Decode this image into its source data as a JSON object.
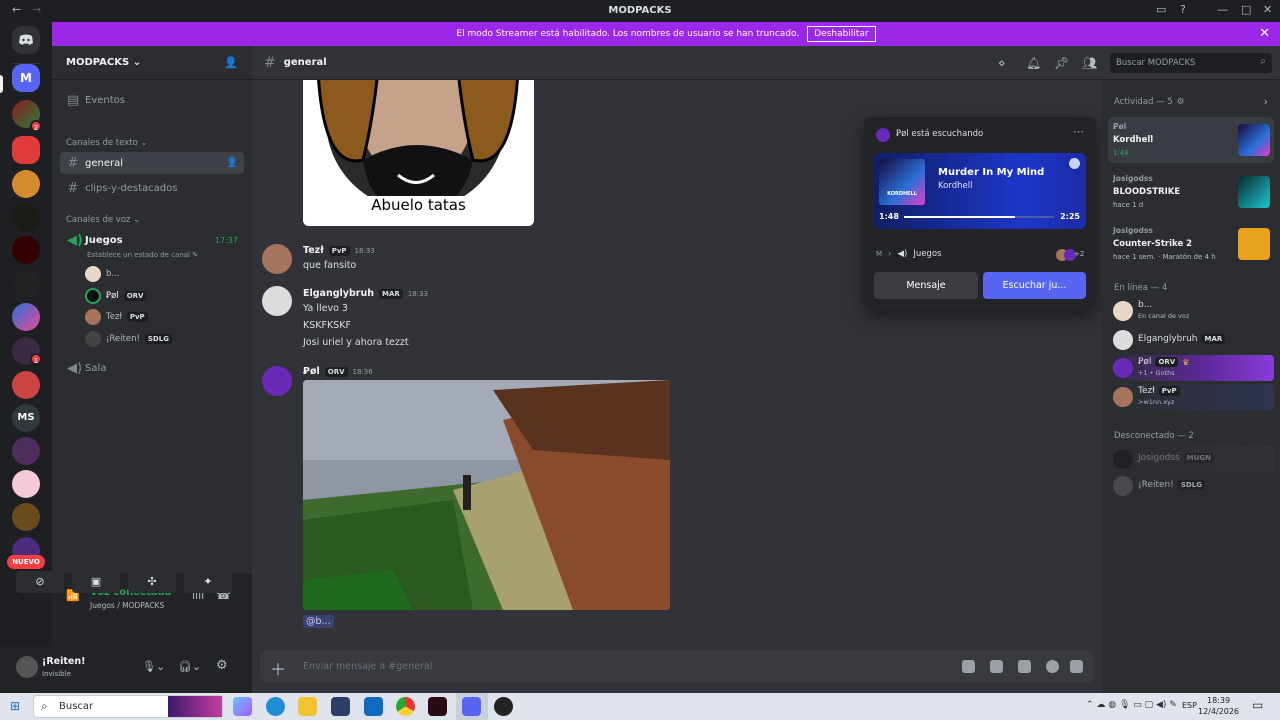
{
  "window": {
    "title": "MODPACKS"
  },
  "banner": {
    "text": "El modo Streamer está habilitado. Los nombres de usuario se han truncado.",
    "button": "Deshabilitar"
  },
  "server": {
    "name": "MODPACKS",
    "badges": [
      "2",
      "1"
    ],
    "new_label": "NUEVO",
    "rail_initial": "M",
    "ms_label": "MS"
  },
  "sidebar": {
    "events": "Eventos",
    "text_category": "Canales de texto",
    "text_channels": [
      "general",
      "clips-y-destacados"
    ],
    "voice_category": "Canales de voz",
    "voice_channel": "Juegos",
    "voice_timer": "17:37",
    "voice_status_prompt": "Establece un estado de canal",
    "voice_users": [
      {
        "name": "b...",
        "tag": ""
      },
      {
        "name": "Ꝑøl",
        "tag": "ORV"
      },
      {
        "name": "Tezł",
        "tag": "PvP"
      },
      {
        "name": "¡Reiten!",
        "tag": "SDLG"
      }
    ],
    "other_voice_channel": "Sala"
  },
  "voice_panel": {
    "status": "Voz conectada",
    "location": "Juegos / MODPACKS"
  },
  "user_panel": {
    "name": "¡Reiten!",
    "status": "Invisible"
  },
  "header": {
    "channel": "general",
    "search_placeholder": "Buscar MODPACKS"
  },
  "messages": [
    {
      "image_caption": "Abuelo tatas"
    },
    {
      "author": "Tezł",
      "tag": "PvP",
      "time": "18:33",
      "lines": [
        "que fansito"
      ]
    },
    {
      "author": "Elganglybruh",
      "tag": "MAR",
      "time": "18:33",
      "lines": [
        "Ya llevo 3",
        "KSKFKSKF",
        "Josi uriel y ahora tezzt"
      ]
    },
    {
      "author": "Ꝑøl",
      "tag": "ORV",
      "time": "18:36",
      "lines": [],
      "mention": "@b..."
    }
  ],
  "composer": {
    "placeholder": "Enviar mensaje a #general"
  },
  "popup": {
    "listening": "Ꝑøl está escuchando",
    "track": "Murder In My Mind",
    "artist": "Kordhell",
    "album_text": "KORDHELL",
    "elapsed": "1:48",
    "duration": "2:25",
    "progress": 0.74,
    "voice_server_initial": "M",
    "voice_channel": "Juegos",
    "extra_count": "+2",
    "message_btn": "Mensaje",
    "listen_btn": "Escuchar ju..."
  },
  "members": {
    "activity_header": "Actividad — 5",
    "activities": [
      {
        "user": "Ꝑøl",
        "title": "Kordhell",
        "sub": "1:48"
      },
      {
        "user": "Josigodss",
        "title": "BLOODSTRIKE",
        "sub": "hace 1 d"
      },
      {
        "user": "Josigodss",
        "title": "Counter-Strike 2",
        "sub": "hace 1 sem. · Maratón de 4 h"
      }
    ],
    "online_header": "En línea — 4",
    "online": [
      {
        "name": "b...",
        "sub": "En canal de voz",
        "tag": ""
      },
      {
        "name": "Elganglybruh",
        "sub": "",
        "tag": "MAR"
      },
      {
        "name": "Ꝑøl",
        "sub": "+1 • Goths",
        "tag": "ORV"
      },
      {
        "name": "Tezł",
        "sub": ">w1nn.xyz",
        "tag": "PvP"
      }
    ],
    "offline_header": "Desconectado — 2",
    "offline": [
      {
        "name": "Josigodss",
        "tag": "MUGN"
      },
      {
        "name": "¡Reiten!",
        "tag": "SDLG"
      }
    ]
  },
  "taskbar": {
    "search": "Buscar",
    "lang": "ESP",
    "time": "18:39",
    "date": "12/4/2026"
  },
  "colors": {
    "accent": "#5865f2",
    "banner": "#9b27e8",
    "online": "#23a559"
  }
}
